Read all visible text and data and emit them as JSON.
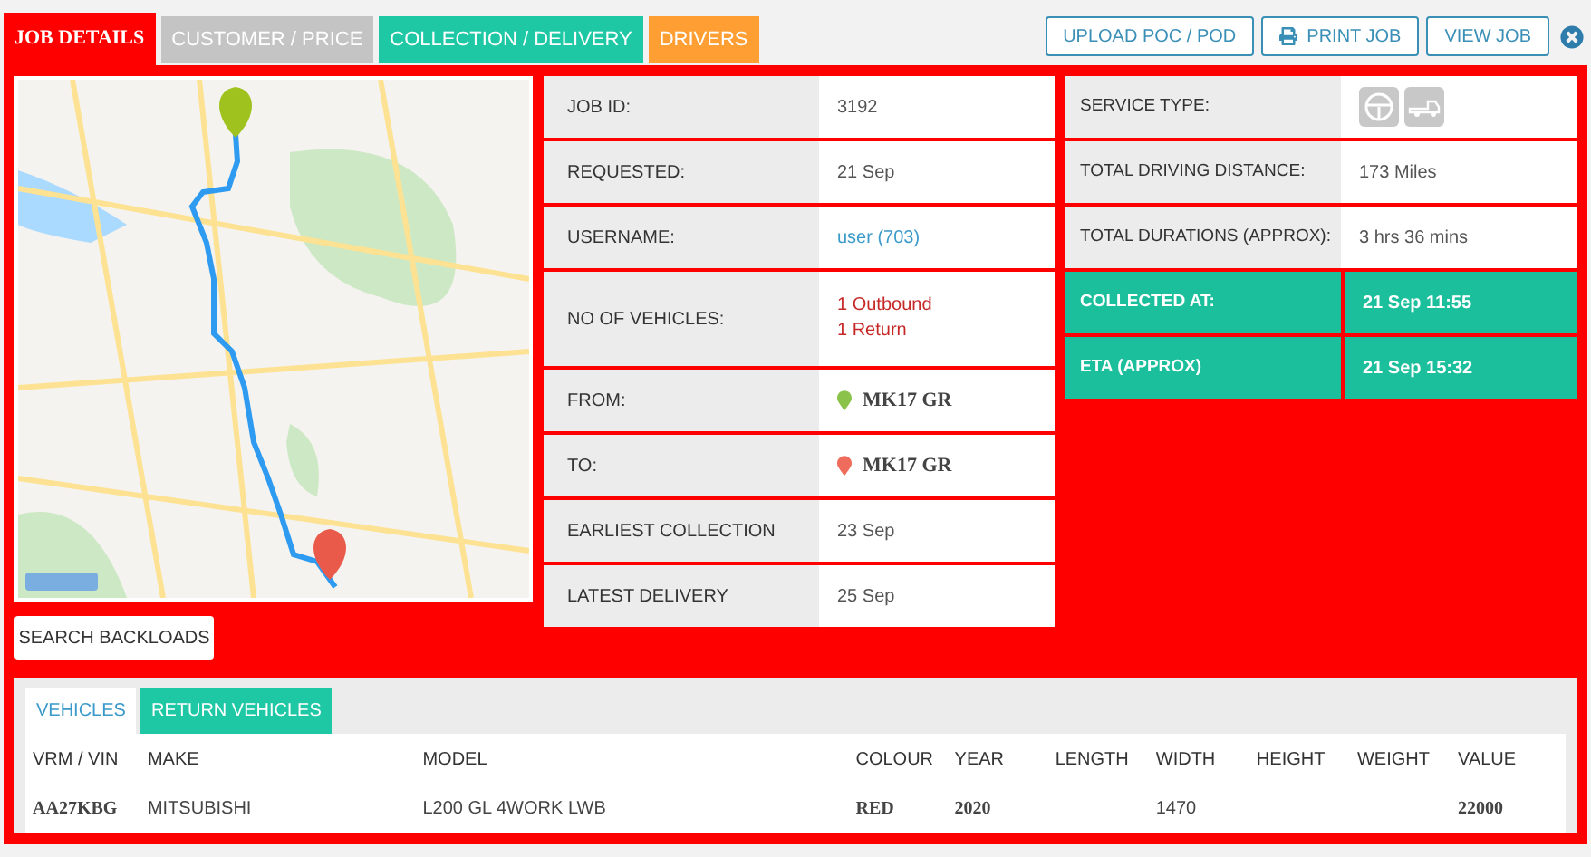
{
  "tabs": [
    {
      "label": "JOB DETAILS",
      "color": "#ff0000",
      "selected": true
    },
    {
      "label": "CUSTOMER / PRICE",
      "color": "#c4c4c4",
      "selected": false
    },
    {
      "label": "COLLECTION / DELIVERY",
      "color": "#1ec8a5",
      "selected": false
    },
    {
      "label": "DRIVERS",
      "color": "#ff9f33",
      "selected": false
    }
  ],
  "actions": [
    {
      "label": "UPLOAD POC / POD",
      "kind": "plain"
    },
    {
      "label": "PRINT JOB",
      "kind": "print"
    },
    {
      "label": "VIEW JOB",
      "kind": "plain"
    }
  ],
  "search_button": "SEARCH BACKLOADS",
  "details": [
    {
      "label": "JOB ID:",
      "kind": "text",
      "values": [
        "3192"
      ]
    },
    {
      "label": "REQUESTED:",
      "kind": "text",
      "values": [
        "21 Sep"
      ]
    },
    {
      "label": "USERNAME:",
      "kind": "link",
      "values": [
        "user (703)"
      ]
    },
    {
      "label": "NO OF VEHICLES:",
      "kind": "alert",
      "values": [
        "1 Outbound",
        "1 Return"
      ]
    },
    {
      "label": "FROM:",
      "kind": "pin",
      "color": "#8bc34a",
      "values": [
        "MK17 GR"
      ]
    },
    {
      "label": "TO:",
      "kind": "pin",
      "color": "#ef6b5b",
      "values": [
        "MK17 GR"
      ]
    },
    {
      "label": "EARLIEST COLLECTION",
      "kind": "text",
      "values": [
        "23 Sep"
      ]
    },
    {
      "label": "LATEST DELIVERY",
      "kind": "text",
      "values": [
        "25 Sep"
      ]
    }
  ],
  "summary": [
    {
      "label": "SERVICE TYPE:",
      "kind": "icons"
    },
    {
      "label": "TOTAL DRIVING DISTANCE:",
      "kind": "text",
      "value": "173 Miles"
    },
    {
      "label": "TOTAL DURATIONS (APPROX):",
      "kind": "text",
      "value": "3 hrs 36 mins"
    },
    {
      "label": "COLLECTED AT:",
      "kind": "highlight",
      "value": "21 Sep 11:55"
    },
    {
      "label": "ETA (APPROX)",
      "kind": "highlight",
      "value": "21 Sep 15:32"
    }
  ],
  "vehicle_tabs": [
    {
      "label": "VEHICLES",
      "selected": true
    },
    {
      "label": "RETURN VEHICLES",
      "selected": false
    }
  ],
  "table": {
    "columns": [
      "VRM / VIN",
      "MAKE",
      "MODEL",
      "COLOUR",
      "YEAR",
      "LENGTH",
      "WIDTH",
      "HEIGHT",
      "WEIGHT",
      "VALUE"
    ],
    "rows": [
      [
        {
          "text": "AA27KBG",
          "serif": true
        },
        {
          "text": "MITSUBISHI",
          "serif": false
        },
        {
          "text": "L200 GL 4WORK LWB",
          "serif": false
        },
        {
          "text": "RED",
          "serif": true
        },
        {
          "text": "2020",
          "serif": true
        },
        null,
        {
          "text": "1470",
          "serif": false
        },
        null,
        null,
        {
          "text": "22000",
          "serif": true
        }
      ]
    ]
  }
}
